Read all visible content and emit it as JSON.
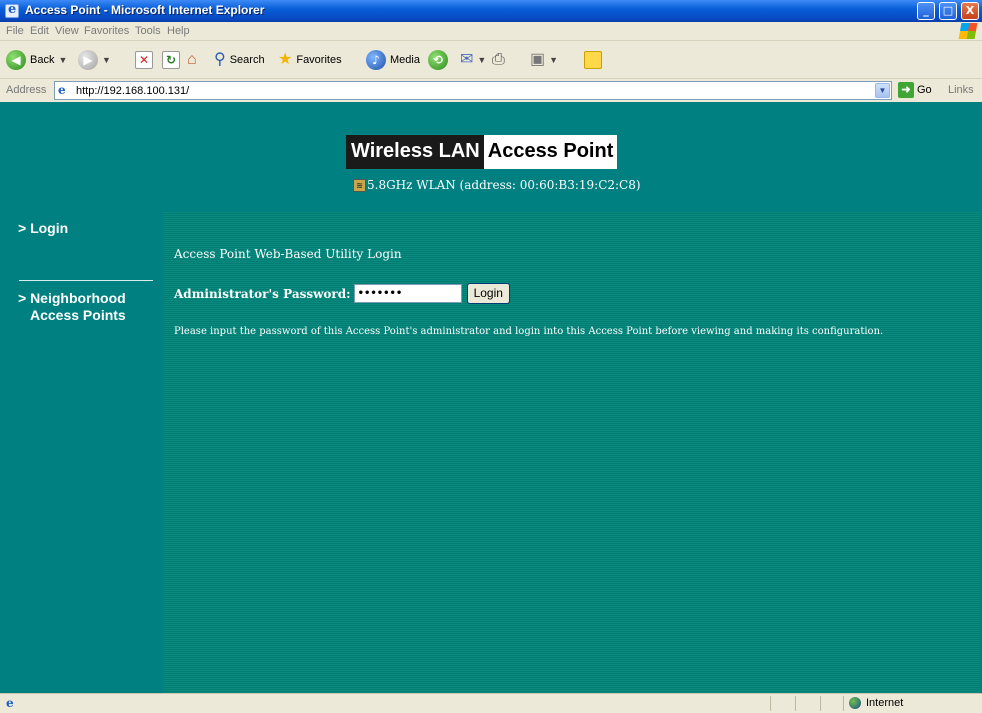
{
  "window": {
    "title": "Access Point - Microsoft Internet Explorer",
    "minimize": "_",
    "maximize": "□",
    "close": "X"
  },
  "menu": [
    "File",
    "Edit",
    "View",
    "Favorites",
    "Tools",
    "Help"
  ],
  "toolbar": {
    "back_label": "Back",
    "search_label": "Search",
    "favorites_label": "Favorites",
    "media_label": "Media"
  },
  "address": {
    "label": "Address",
    "url": "http://192.168.100.131/",
    "go_label": "Go",
    "links_label": "Links"
  },
  "page": {
    "banner_dark": "Wireless LAN",
    "banner_light": "Access Point",
    "subtitle": "5.8GHz WLAN (address: 00:60:B3:19:C2:C8)",
    "nav": {
      "login": "> Login",
      "neighborhood_line1": "> Neighborhood",
      "neighborhood_line2": "Access Points"
    },
    "utility_title": "Access Point Web-Based Utility Login",
    "password_label": "Administrator's Password:",
    "password_value": "•••••••",
    "login_button": "Login",
    "instructions": "Please input the password of this Access Point's administrator and login into this Access Point before viewing and making its configuration."
  },
  "status": {
    "zone": "Internet"
  },
  "colors": {
    "page_background": "#008080",
    "main_panel": "#0a8a7f",
    "banner_dark": "#1a1a1a",
    "banner_light": "#ffffff"
  }
}
